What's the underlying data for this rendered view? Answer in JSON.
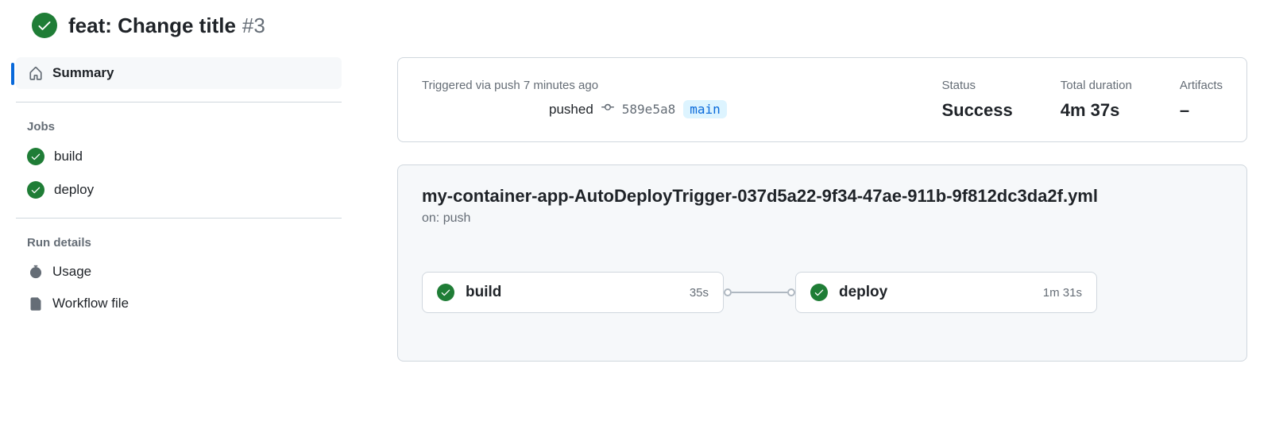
{
  "header": {
    "title": "feat: Change title",
    "number": "#3"
  },
  "sidebar": {
    "summary": "Summary",
    "jobs_heading": "Jobs",
    "jobs": [
      {
        "name": "build"
      },
      {
        "name": "deploy"
      }
    ],
    "run_details_heading": "Run details",
    "usage": "Usage",
    "workflow_file": "Workflow file"
  },
  "summary": {
    "trigger_label": "Triggered via push 7 minutes ago",
    "pushed_label": "pushed",
    "commit_sha": "589e5a8",
    "branch": "main",
    "status_label": "Status",
    "status_value": "Success",
    "duration_label": "Total duration",
    "duration_value": "4m 37s",
    "artifacts_label": "Artifacts",
    "artifacts_value": "–"
  },
  "workflow": {
    "filename": "my-container-app-AutoDeployTrigger-037d5a22-9f34-47ae-911b-9f812dc3da2f.yml",
    "trigger": "on: push",
    "jobs": [
      {
        "name": "build",
        "duration": "35s"
      },
      {
        "name": "deploy",
        "duration": "1m 31s"
      }
    ]
  }
}
